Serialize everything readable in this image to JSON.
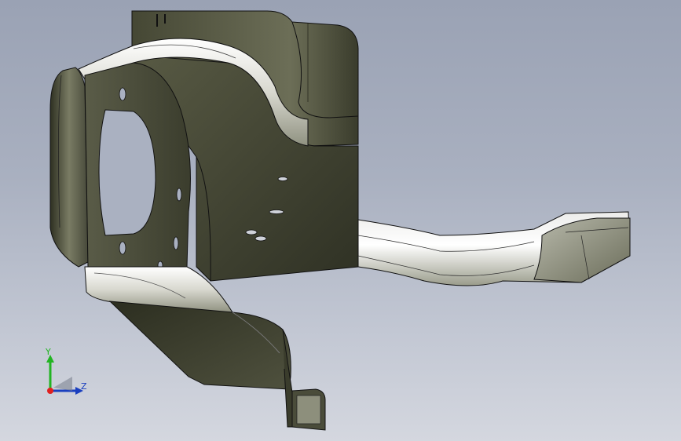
{
  "viewport": {
    "background_top": "#9aa2b4",
    "background_bottom": "#d4d7df"
  },
  "model": {
    "description_icon": "sheet-metal-bracket-model",
    "body_color": "#3f4131",
    "highlight_color": "#f4f4ee",
    "edge_color": "#111111"
  },
  "triad": {
    "x_label": "",
    "y_label": "Y",
    "z_label": "Z",
    "x_color": "#e02020",
    "y_color": "#22b422",
    "z_color": "#1a3fbf"
  }
}
